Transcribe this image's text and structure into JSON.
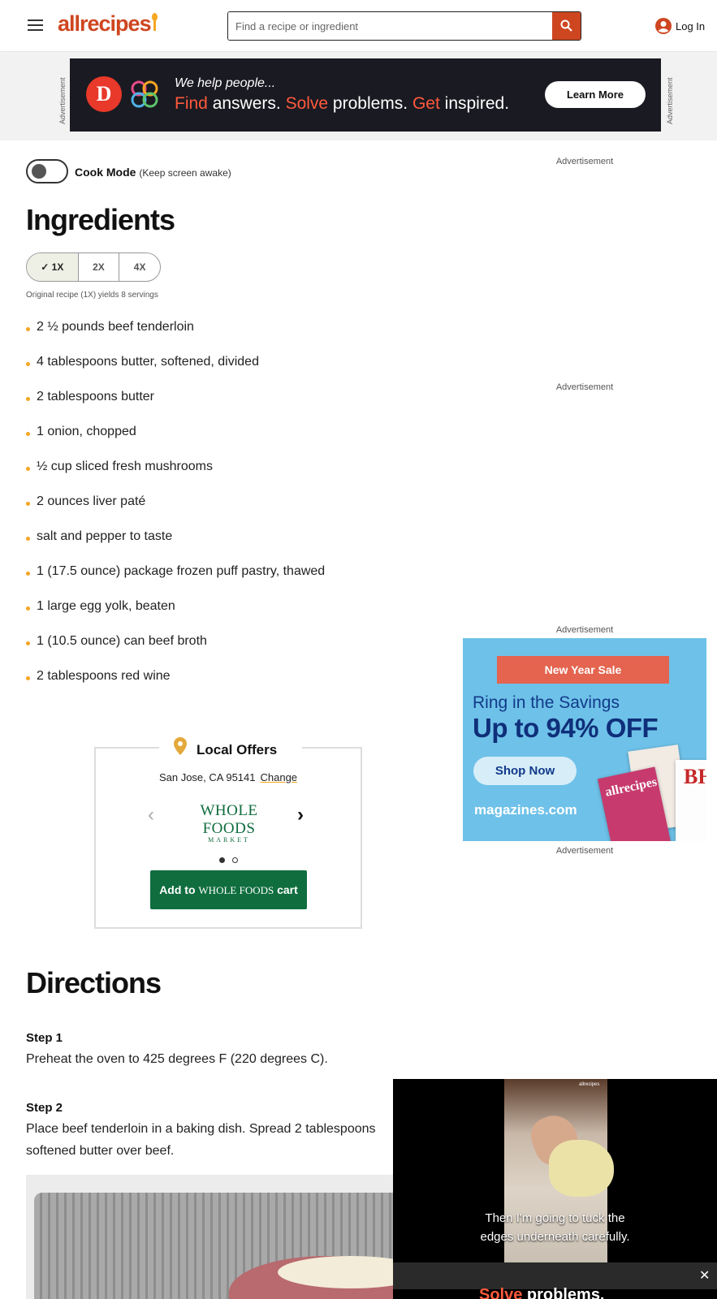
{
  "header": {
    "logo": "allrecipes",
    "search_placeholder": "Find a recipe or ingredient",
    "login_label": "Log In",
    "icons": {
      "menu": "hamburger-icon",
      "search": "search-icon",
      "user": "user-circle-icon"
    }
  },
  "top_ad": {
    "side_label": "Advertisement",
    "tagline": "We help people...",
    "headline_parts": [
      "Find",
      " answers. ",
      "Solve",
      " problems. ",
      "Get",
      " inspired."
    ],
    "button": "Learn More",
    "brand_letter": "D"
  },
  "cook_mode": {
    "label": "Cook Mode",
    "sub": "(Keep screen awake)"
  },
  "ingredients": {
    "title": "Ingredients",
    "scales": [
      "1X",
      "2X",
      "4X"
    ],
    "selected_scale": "1X",
    "yield_note": "Original recipe (1X) yields 8 servings",
    "items": [
      "2 ½ pounds beef tenderloin",
      "4 tablespoons butter, softened, divided",
      "2 tablespoons butter",
      "1 onion, chopped",
      "½ cup sliced fresh mushrooms",
      "2 ounces liver paté",
      "salt and pepper to taste",
      "1 (17.5 ounce) package frozen puff pastry, thawed",
      "1 large egg yolk, beaten",
      "1 (10.5 ounce) can beef broth",
      "2 tablespoons red wine"
    ]
  },
  "right_ads": {
    "label": "Advertisement",
    "magazine": {
      "ribbon": "New Year Sale",
      "line1": "Ring in the Savings",
      "line2": "Up to 94% OFF",
      "button": "Shop Now",
      "brand": "magazines.com",
      "cover_a": "allrecipes",
      "cover_b": "BH"
    }
  },
  "local_offers": {
    "title": "Local Offers",
    "location": "San Jose, CA 95141",
    "change_link": "Change",
    "store_name": "WHOLE FOODS",
    "store_sub": "MARKET",
    "cart_button_prefix": "Add to",
    "cart_button_store": "WHOLE FOODS",
    "cart_button_suffix": "cart"
  },
  "directions": {
    "title": "Directions",
    "steps": [
      {
        "label": "Step 1",
        "text": "Preheat the oven to 425 degrees F (220 degrees C)."
      },
      {
        "label": "Step 2",
        "text": "Place beef tenderloin in a baking dish. Spread 2 tablespoons softened butter over beef."
      }
    ]
  },
  "video": {
    "brand": "allrecipes",
    "caption_line1": "Then I'm going to tuck the",
    "caption_line2": "edges underneath carefully.",
    "close": "✕",
    "peek_hl": "Solve",
    "peek_rest": " problems."
  }
}
